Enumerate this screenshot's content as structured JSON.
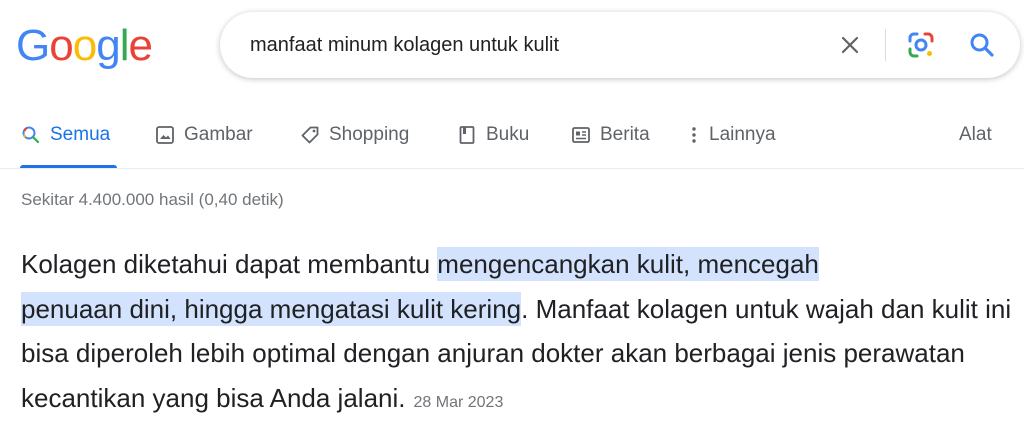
{
  "logo": {
    "letters": [
      "G",
      "o",
      "o",
      "g",
      "l",
      "e"
    ],
    "colors": [
      "#4285F4",
      "#EA4335",
      "#FBBC05",
      "#4285F4",
      "#34A853",
      "#EA4335"
    ]
  },
  "search": {
    "query": "manfaat minum kolagen untuk kulit",
    "icons": {
      "clear": "close-icon",
      "lens": "google-lens-icon",
      "search": "search-icon"
    }
  },
  "tabs": [
    {
      "label": "Semua",
      "icon": "search-icon",
      "active": true
    },
    {
      "label": "Gambar",
      "icon": "image-icon",
      "active": false
    },
    {
      "label": "Shopping",
      "icon": "tag-icon",
      "active": false
    },
    {
      "label": "Buku",
      "icon": "book-icon",
      "active": false
    },
    {
      "label": "Berita",
      "icon": "news-icon",
      "active": false
    },
    {
      "label": "Lainnya",
      "icon": "more-vert-icon",
      "active": false
    }
  ],
  "tools_label": "Alat",
  "result_stats": "Sekitar 4.400.000 hasil (0,40 detik)",
  "snippet": {
    "text_before": "Kolagen diketahui dapat membantu ",
    "highlight_line1": "mengencangkan kulit, mencegah",
    "highlight_line2": "penuaan dini, hingga mengatasi kulit kering",
    "text_after": ". Manfaat kolagen untuk wajah dan kulit ini bisa diperoleh lebih optimal dengan anjuran dokter akan berbagai jenis perawatan kecantikan yang bisa Anda jalani.",
    "date": "28 Mar 2023"
  },
  "colors": {
    "accent": "#1a73e8",
    "highlight": "#d3e3fd",
    "muted_text": "#70757a"
  }
}
